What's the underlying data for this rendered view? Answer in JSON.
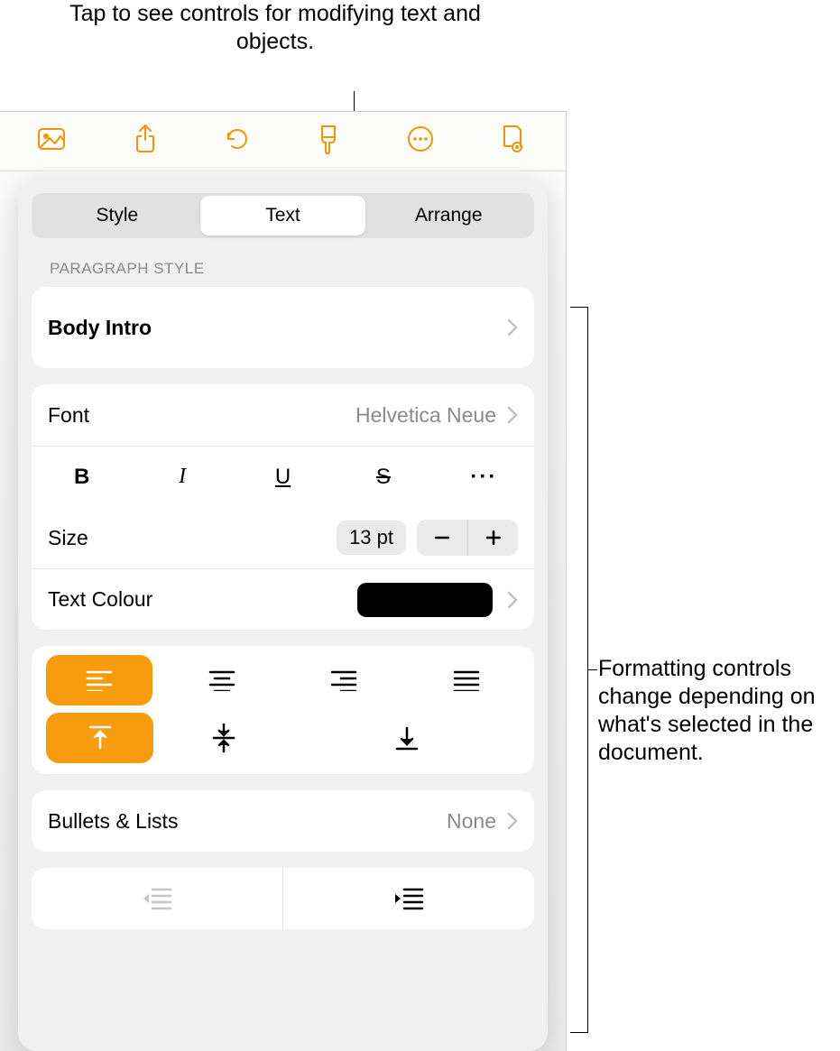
{
  "callouts": {
    "top": "Tap to see controls for modifying text and objects.",
    "right": "Formatting controls change depending on what's selected in the document."
  },
  "tabs": {
    "style": "Style",
    "text": "Text",
    "arrange": "Arrange"
  },
  "section_labels": {
    "paragraph_style": "Paragraph Style"
  },
  "paragraph_style": {
    "value": "Body Intro"
  },
  "font": {
    "label": "Font",
    "value": "Helvetica Neue"
  },
  "size": {
    "label": "Size",
    "value": "13 pt"
  },
  "text_colour": {
    "label": "Text Colour",
    "value_hex": "#000000"
  },
  "bullets": {
    "label": "Bullets & Lists",
    "value": "None"
  },
  "format_letters": {
    "bold": "B",
    "italic": "I",
    "underline": "U",
    "strike": "S"
  },
  "icons": {
    "more": "···"
  }
}
